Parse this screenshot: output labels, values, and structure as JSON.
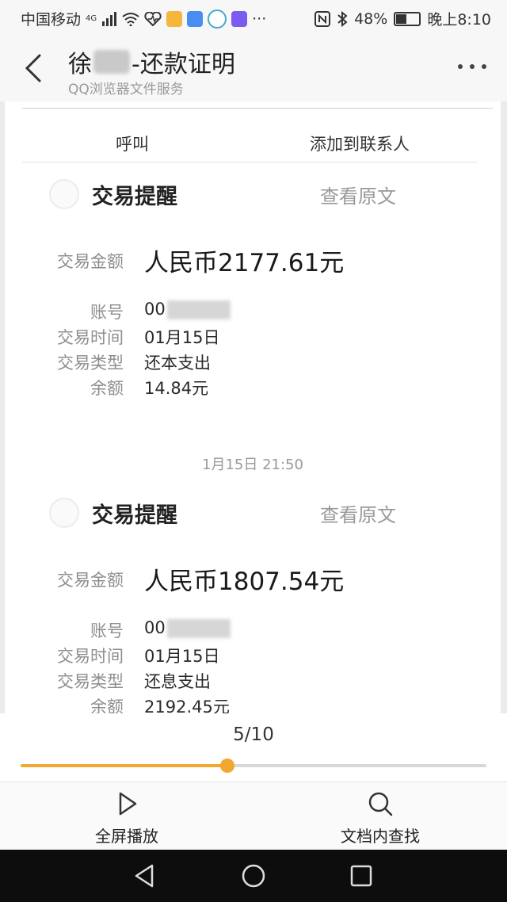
{
  "status_bar": {
    "carrier": "中国移动",
    "network": "4G",
    "battery": "48%",
    "battery_level": 0.48,
    "time": "晚上8:10",
    "overflow": "···"
  },
  "header": {
    "title_start": "徐",
    "title_end": "-还款证明",
    "subtitle": "QQ浏览器文件服务"
  },
  "doc": {
    "actions": {
      "call": "呼叫",
      "add_contact": "添加到联系人"
    },
    "cards": [
      {
        "title": "交易提醒",
        "view_original": "查看原文",
        "amount_label": "交易金额",
        "amount": "人民币2177.61元",
        "account_label": "账号",
        "account": "00",
        "time_label": "交易时间",
        "time": "01月15日",
        "type_label": "交易类型",
        "type": "还本支出",
        "balance_label": "余额",
        "balance": "14.84元"
      },
      {
        "title": "交易提醒",
        "view_original": "查看原文",
        "amount_label": "交易金额",
        "amount": "人民币1807.54元",
        "account_label": "账号",
        "account": "00",
        "time_label": "交易时间",
        "time": "01月15日",
        "type_label": "交易类型",
        "type": "还息支出",
        "balance_label": "余额",
        "balance": "2192.45元"
      }
    ],
    "timestamp": "1月15日 21:50"
  },
  "pager": {
    "indicator": "5/10",
    "progress": 0.444
  },
  "toolbar": {
    "fullscreen_label": "全屏播放",
    "search_label": "文档内查找"
  },
  "colors": {
    "accent": "#f0a830",
    "nav_bar": "#0d0d0d"
  }
}
